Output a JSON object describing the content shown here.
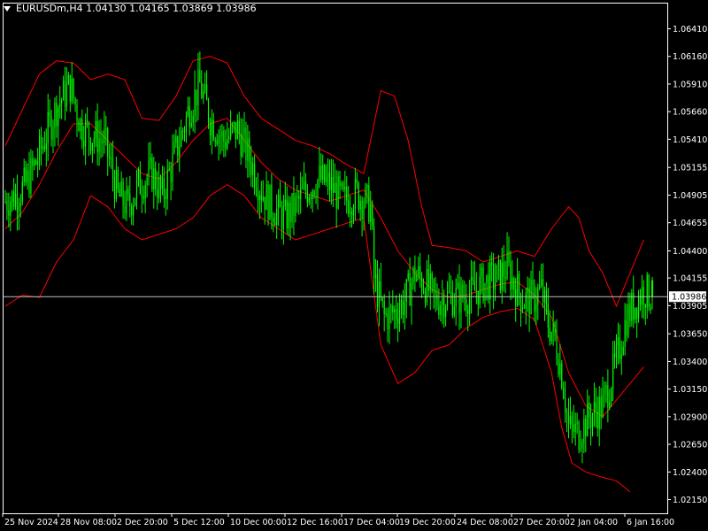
{
  "header": {
    "symbol_line": "EURUSDm,H4  1.04130 1.04165 1.03869 1.03986",
    "menu_icon": "triangle-down-icon"
  },
  "colors": {
    "background": "#000000",
    "frame": "#ffffff",
    "candle": "#00ff00",
    "bands": "#ff0000",
    "price_line": "#c0c0c0"
  },
  "chart_data": {
    "type": "candlestick",
    "symbol": "EURUSDm",
    "timeframe": "H4",
    "ohlc_header": {
      "open": 1.0413,
      "high": 1.04165,
      "low": 1.03869,
      "close": 1.03986
    },
    "current_price": 1.03986,
    "current_price_label": "1.03986",
    "ylim": [
      1.0205,
      1.0655
    ],
    "y_ticks": [
      "1.06410",
      "1.06160",
      "1.05910",
      "1.05660",
      "1.05410",
      "1.05155",
      "1.04905",
      "1.04655",
      "1.04400",
      "1.04155",
      "1.03905",
      "1.03650",
      "1.03400",
      "1.03150",
      "1.02900",
      "1.02650",
      "1.02400",
      "1.02150"
    ],
    "x_ticks": [
      "25 Nov 2024",
      "28 Nov 08:00",
      "2 Dec 20:00",
      "5 Dec 12:00",
      "10 Dec 00:00",
      "12 Dec 16:00",
      "17 Dec 04:00",
      "19 Dec 20:00",
      "24 Dec 08:00",
      "27 Dec 20:00",
      "2 Jan 04:00",
      "6 Jan 16:00"
    ],
    "indicator": "Bollinger Bands",
    "close_path": [
      [
        0,
        1.0485
      ],
      [
        6,
        1.049
      ],
      [
        12,
        1.05
      ],
      [
        18,
        1.052
      ],
      [
        24,
        1.0545
      ],
      [
        30,
        1.057
      ],
      [
        38,
        1.059
      ],
      [
        44,
        1.0555
      ],
      [
        50,
        1.0545
      ],
      [
        58,
        1.054
      ],
      [
        66,
        1.049
      ],
      [
        72,
        1.048
      ],
      [
        78,
        1.05
      ],
      [
        86,
        1.051
      ],
      [
        92,
        1.049
      ],
      [
        100,
        1.053
      ],
      [
        108,
        1.057
      ],
      [
        114,
        1.059
      ],
      [
        120,
        1.056
      ],
      [
        128,
        1.054
      ],
      [
        136,
        1.055
      ],
      [
        144,
        1.052
      ],
      [
        150,
        1.0495
      ],
      [
        156,
        1.048
      ],
      [
        164,
        1.047
      ],
      [
        170,
        1.048
      ],
      [
        176,
        1.0495
      ],
      [
        184,
        1.0505
      ],
      [
        190,
        1.05
      ],
      [
        198,
        1.0485
      ],
      [
        206,
        1.0492
      ],
      [
        214,
        1.048
      ],
      [
        216,
        1.0415
      ],
      [
        222,
        1.038
      ],
      [
        228,
        1.0385
      ],
      [
        234,
        1.0395
      ],
      [
        240,
        1.042
      ],
      [
        246,
        1.041
      ],
      [
        252,
        1.0395
      ],
      [
        258,
        1.0398
      ],
      [
        266,
        1.0398
      ],
      [
        272,
        1.04
      ],
      [
        280,
        1.041
      ],
      [
        288,
        1.0415
      ],
      [
        294,
        1.0425
      ],
      [
        298,
        1.041
      ],
      [
        304,
        1.0395
      ],
      [
        310,
        1.0398
      ],
      [
        314,
        1.0405
      ],
      [
        318,
        1.0375
      ],
      [
        322,
        1.036
      ],
      [
        326,
        1.033
      ],
      [
        330,
        1.028
      ],
      [
        336,
        1.0275
      ],
      [
        342,
        1.029
      ],
      [
        350,
        1.03
      ],
      [
        358,
        1.034
      ],
      [
        364,
        1.038
      ],
      [
        370,
        1.0395
      ],
      [
        374,
        1.0405
      ],
      [
        378,
        1.03986
      ]
    ],
    "upper_band": [
      [
        0,
        1.0535
      ],
      [
        10,
        1.0568
      ],
      [
        20,
        1.06
      ],
      [
        30,
        1.0612
      ],
      [
        40,
        1.061
      ],
      [
        50,
        1.0595
      ],
      [
        60,
        1.06
      ],
      [
        70,
        1.0595
      ],
      [
        80,
        1.056
      ],
      [
        90,
        1.0558
      ],
      [
        100,
        1.058
      ],
      [
        110,
        1.0612
      ],
      [
        120,
        1.0616
      ],
      [
        130,
        1.061
      ],
      [
        140,
        1.058
      ],
      [
        150,
        1.056
      ],
      [
        160,
        1.055
      ],
      [
        170,
        1.054
      ],
      [
        180,
        1.0535
      ],
      [
        190,
        1.0528
      ],
      [
        200,
        1.0518
      ],
      [
        210,
        1.051
      ],
      [
        220,
        1.0585
      ],
      [
        228,
        1.058
      ],
      [
        236,
        1.054
      ],
      [
        244,
        1.048
      ],
      [
        250,
        1.0445
      ],
      [
        260,
        1.0443
      ],
      [
        270,
        1.044
      ],
      [
        280,
        1.043
      ],
      [
        290,
        1.0435
      ],
      [
        300,
        1.044
      ],
      [
        310,
        1.0435
      ],
      [
        320,
        1.046
      ],
      [
        330,
        1.048
      ],
      [
        336,
        1.047
      ],
      [
        342,
        1.044
      ],
      [
        350,
        1.042
      ],
      [
        358,
        1.039
      ],
      [
        366,
        1.042
      ],
      [
        374,
        1.045
      ]
    ],
    "middle_band": [
      [
        0,
        1.046
      ],
      [
        10,
        1.0475
      ],
      [
        20,
        1.05
      ],
      [
        30,
        1.053
      ],
      [
        40,
        1.0555
      ],
      [
        50,
        1.0555
      ],
      [
        60,
        1.054
      ],
      [
        70,
        1.0525
      ],
      [
        80,
        1.051
      ],
      [
        90,
        1.0505
      ],
      [
        100,
        1.052
      ],
      [
        110,
        1.054
      ],
      [
        120,
        1.0555
      ],
      [
        130,
        1.056
      ],
      [
        140,
        1.054
      ],
      [
        150,
        1.052
      ],
      [
        160,
        1.0505
      ],
      [
        170,
        1.0495
      ],
      [
        180,
        1.049
      ],
      [
        190,
        1.0485
      ],
      [
        200,
        1.049
      ],
      [
        210,
        1.0495
      ],
      [
        220,
        1.047
      ],
      [
        230,
        1.044
      ],
      [
        240,
        1.042
      ],
      [
        250,
        1.0405
      ],
      [
        260,
        1.0398
      ],
      [
        270,
        1.04
      ],
      [
        280,
        1.0405
      ],
      [
        290,
        1.041
      ],
      [
        300,
        1.0412
      ],
      [
        310,
        1.04
      ],
      [
        320,
        1.038
      ],
      [
        330,
        1.033
      ],
      [
        340,
        1.03
      ],
      [
        350,
        1.029
      ],
      [
        358,
        1.0305
      ],
      [
        366,
        1.032
      ],
      [
        374,
        1.0335
      ]
    ],
    "lower_band": [
      [
        0,
        1.039
      ],
      [
        10,
        1.04
      ],
      [
        20,
        1.0398
      ],
      [
        30,
        1.043
      ],
      [
        40,
        1.045
      ],
      [
        50,
        1.049
      ],
      [
        60,
        1.048
      ],
      [
        70,
        1.046
      ],
      [
        80,
        1.045
      ],
      [
        90,
        1.0455
      ],
      [
        100,
        1.046
      ],
      [
        110,
        1.047
      ],
      [
        120,
        1.049
      ],
      [
        130,
        1.05
      ],
      [
        140,
        1.049
      ],
      [
        150,
        1.047
      ],
      [
        160,
        1.046
      ],
      [
        170,
        1.045
      ],
      [
        180,
        1.0455
      ],
      [
        190,
        1.046
      ],
      [
        200,
        1.0465
      ],
      [
        210,
        1.047
      ],
      [
        220,
        1.0355
      ],
      [
        230,
        1.032
      ],
      [
        240,
        1.033
      ],
      [
        250,
        1.035
      ],
      [
        260,
        1.0355
      ],
      [
        270,
        1.037
      ],
      [
        280,
        1.038
      ],
      [
        290,
        1.0385
      ],
      [
        300,
        1.0388
      ],
      [
        310,
        1.0378
      ],
      [
        320,
        1.033
      ],
      [
        326,
        1.028
      ],
      [
        332,
        1.0248
      ],
      [
        340,
        1.024
      ],
      [
        350,
        1.0235
      ],
      [
        358,
        1.0232
      ],
      [
        366,
        1.0222
      ]
    ]
  }
}
